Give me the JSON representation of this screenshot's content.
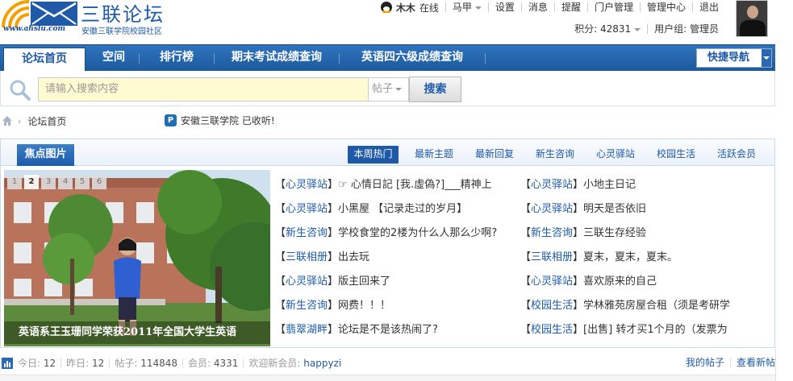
{
  "site": {
    "title": "三联论坛",
    "subtitle": "安徽三联学院校园社区",
    "url": "www.ahslu.com"
  },
  "topbar": {
    "username": "木木",
    "status": "在线",
    "links": [
      "马甲",
      "设置",
      "消息",
      "提醒",
      "门户管理",
      "管理中心",
      "退出"
    ],
    "score_label": "积分: 42831",
    "usergroup_label": "用户组: 管理员"
  },
  "nav": {
    "tabs": [
      "论坛首页",
      "空间",
      "排行榜",
      "期末考试成绩查询",
      "英语四六级成绩查询"
    ],
    "active_index": 0,
    "quick_nav": "快捷导航"
  },
  "search": {
    "placeholder": "请输入搜索内容",
    "type": "帖子",
    "button": "搜索"
  },
  "breadcrumb": {
    "current": "论坛首页",
    "notice": "安徽三联学院 已收听!"
  },
  "focus": {
    "title": "焦点图片",
    "pages": [
      "1",
      "2",
      "3",
      "4",
      "5",
      "6"
    ],
    "active_page": "2",
    "caption": "英语系王玉珊同学荣获2011年全国大学生英语"
  },
  "hot_tabs": [
    "本周热门",
    "最新主题",
    "最新回复",
    "新生咨询",
    "心灵驿站",
    "校园生活",
    "活跃会员"
  ],
  "threads_left": [
    {
      "cat": "心灵驿站",
      "title": "☞ 心情日記 [我.虛偽?]___精神上"
    },
    {
      "cat": "心灵驿站",
      "title": "小黑屋 【记录走过的岁月】"
    },
    {
      "cat": "新生咨询",
      "title": "学校食堂的2楼为什么人那么少啊?"
    },
    {
      "cat": "三联相册",
      "title": "出去玩"
    },
    {
      "cat": "心灵驿站",
      "title": "版主回来了"
    },
    {
      "cat": "新生咨询",
      "title": "网费！！！"
    },
    {
      "cat": "翡翠湖畔",
      "title": "论坛是不是该热闹了?"
    }
  ],
  "threads_right": [
    {
      "cat": "心灵驿站",
      "title": "小地主日记"
    },
    {
      "cat": "心灵驿站",
      "title": "明天是否依旧"
    },
    {
      "cat": "新生咨询",
      "title": "三联生存经验"
    },
    {
      "cat": "三联相册",
      "title": "夏末，夏末，夏末。"
    },
    {
      "cat": "心灵驿站",
      "title": "喜欢原来的自己"
    },
    {
      "cat": "校园生活",
      "title": "学林雅苑房屋合租（须是考研学"
    },
    {
      "cat": "校园生活",
      "title": "[出售] 转才买1个月的（发票为"
    }
  ],
  "stats": {
    "today_label": "今日:",
    "today": "12",
    "yesterday_label": "昨日:",
    "yesterday": "12",
    "posts_label": "帖子:",
    "posts": "114848",
    "members_label": "会员:",
    "members": "4331",
    "welcome_label": "欢迎新会员:",
    "new_member": "happyzi",
    "my_posts": "我的帖子",
    "new_posts": "查看新帖"
  },
  "colors": {
    "brand": "#1e5aa8",
    "nav_bg": "#2a68b3",
    "search_bg": "#fefbd0"
  }
}
